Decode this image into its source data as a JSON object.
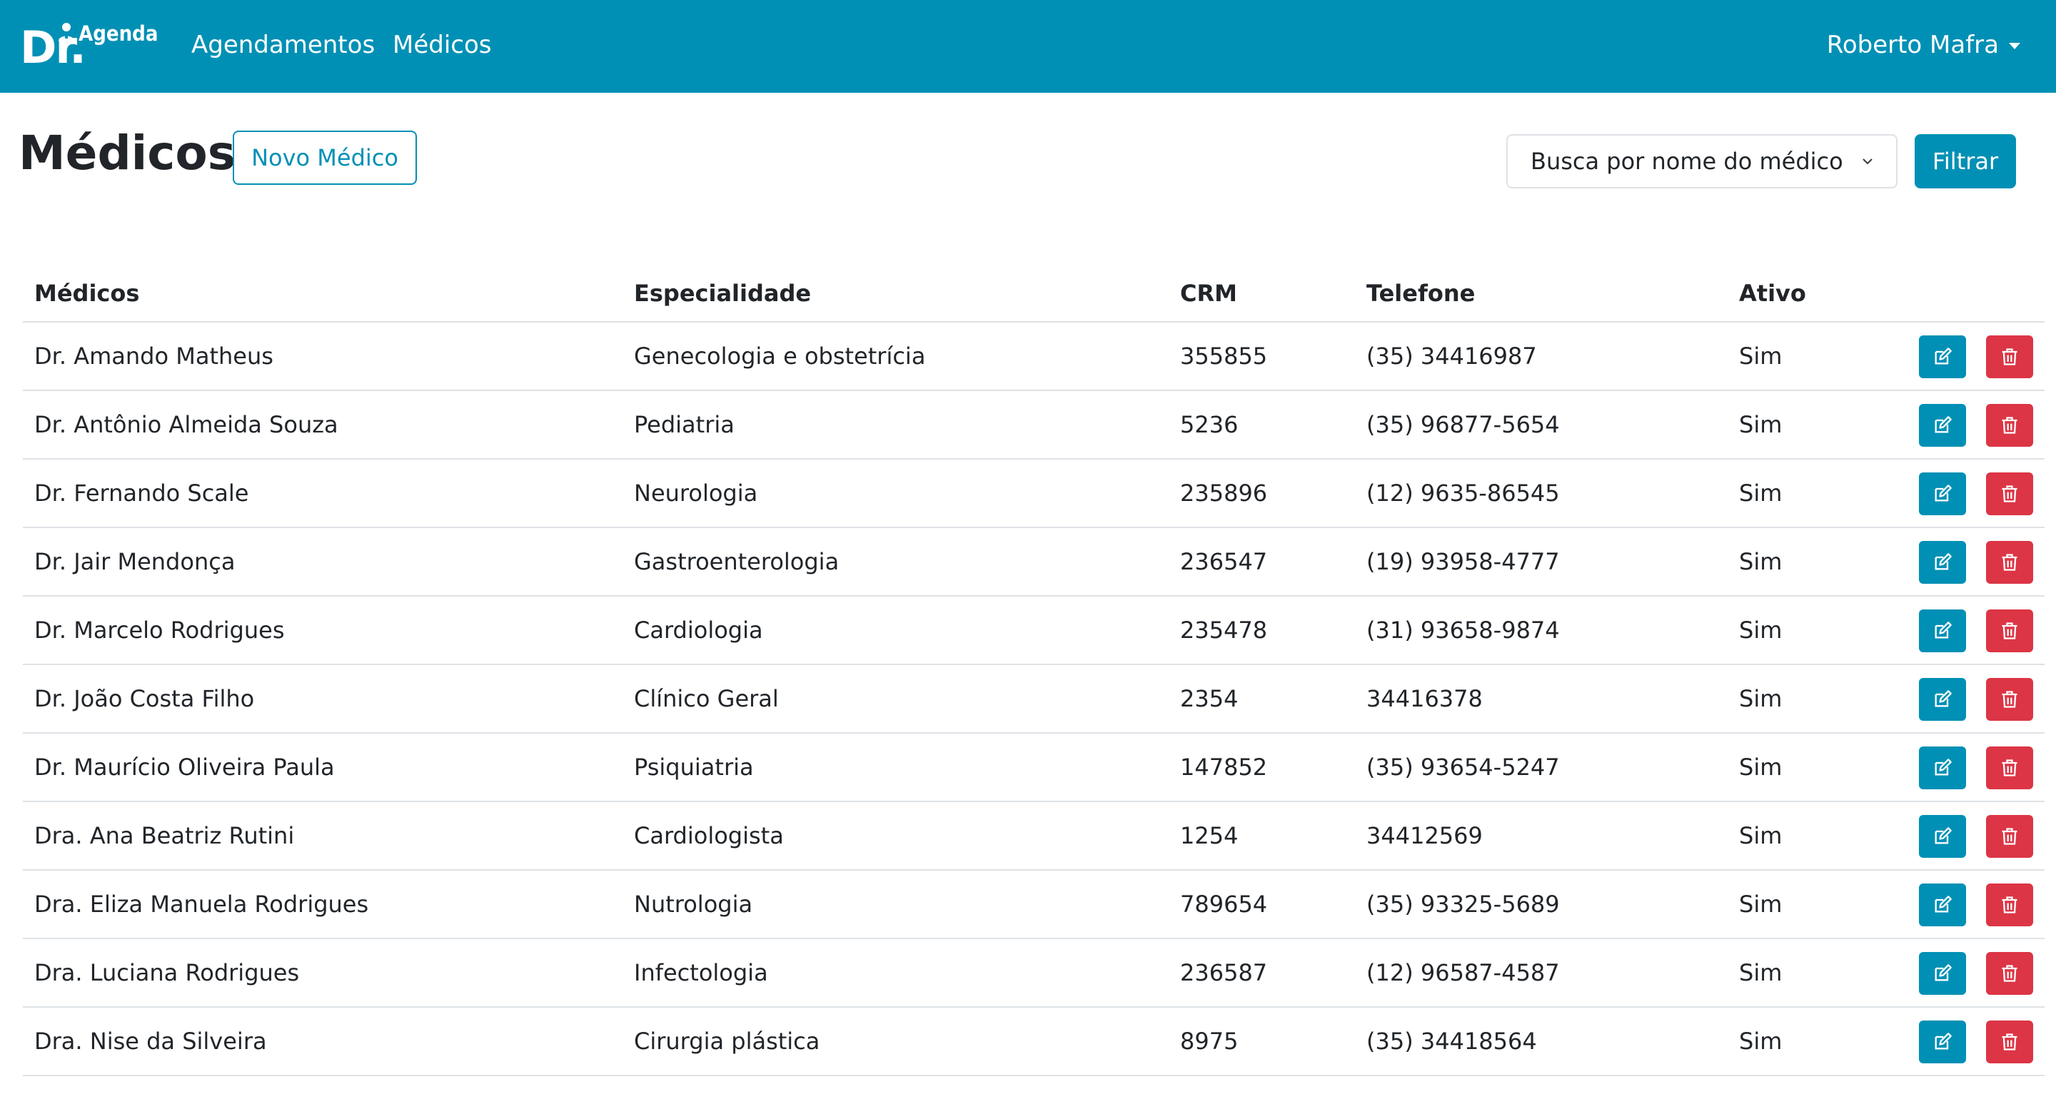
{
  "nav": {
    "brand_dr": "Dr.",
    "brand_agenda": "Agenda",
    "links": [
      "Agendamentos",
      "Médicos"
    ],
    "user": "Roberto Mafra"
  },
  "page": {
    "title": "Médicos",
    "new_button": "Novo Médico",
    "filter_select_value": "Busca por nome do médico",
    "filter_button": "Filtrar"
  },
  "table": {
    "headers": [
      "Médicos",
      "Especialidade",
      "CRM",
      "Telefone",
      "Ativo"
    ],
    "rows": [
      {
        "name": "Dr. Amando Matheus",
        "esp": "Genecologia e obstetrícia",
        "crm": "355855",
        "tel": "(35) 34416987",
        "ativo": "Sim"
      },
      {
        "name": "Dr. Antônio Almeida Souza",
        "esp": "Pediatria",
        "crm": "5236",
        "tel": "(35) 96877-5654",
        "ativo": "Sim"
      },
      {
        "name": "Dr. Fernando Scale",
        "esp": "Neurologia",
        "crm": "235896",
        "tel": "(12) 9635-86545",
        "ativo": "Sim"
      },
      {
        "name": "Dr. Jair Mendonça",
        "esp": "Gastroenterologia",
        "crm": "236547",
        "tel": "(19) 93958-4777",
        "ativo": "Sim"
      },
      {
        "name": "Dr. Marcelo Rodrigues",
        "esp": "Cardiologia",
        "crm": "235478",
        "tel": "(31) 93658-9874",
        "ativo": "Sim"
      },
      {
        "name": "Dr. João Costa Filho",
        "esp": "Clínico Geral",
        "crm": "2354",
        "tel": "34416378",
        "ativo": "Sim"
      },
      {
        "name": "Dr. Maurício Oliveira Paula",
        "esp": "Psiquiatria",
        "crm": "147852",
        "tel": "(35) 93654-5247",
        "ativo": "Sim"
      },
      {
        "name": "Dra. Ana Beatriz Rutini",
        "esp": "Cardiologista",
        "crm": "1254",
        "tel": "34412569",
        "ativo": "Sim"
      },
      {
        "name": "Dra. Eliza Manuela Rodrigues",
        "esp": "Nutrologia",
        "crm": "789654",
        "tel": "(35) 93325-5689",
        "ativo": "Sim"
      },
      {
        "name": "Dra. Luciana Rodrigues",
        "esp": "Infectologia",
        "crm": "236587",
        "tel": "(12) 96587-4587",
        "ativo": "Sim"
      },
      {
        "name": "Dra. Nise da Silveira",
        "esp": "Cirurgia plástica",
        "crm": "8975",
        "tel": "(35) 34418564",
        "ativo": "Sim"
      }
    ],
    "row_actions": {
      "edit_icon": "edit-icon",
      "delete_icon": "trash-icon"
    }
  },
  "colors": {
    "primary": "#0190b5",
    "danger": "#dc3545",
    "border": "#dee2e6"
  }
}
